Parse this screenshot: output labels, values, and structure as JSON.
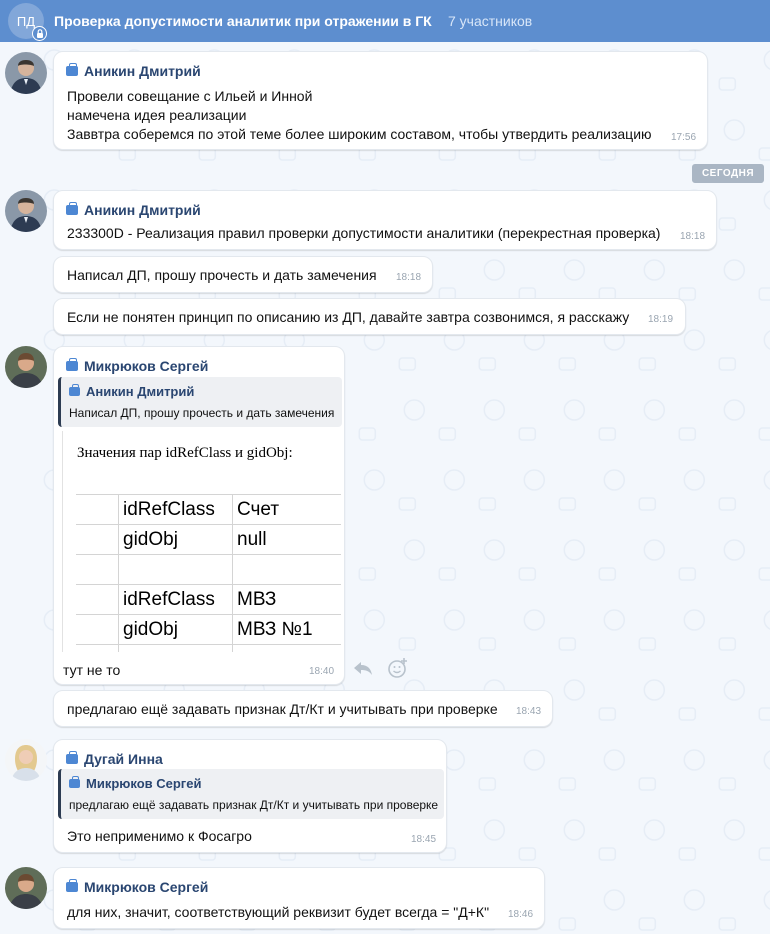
{
  "header": {
    "avatar_initials": "ПД",
    "title": "Проверка допустимости аналитик при отражении в ГК",
    "members": "7 участников"
  },
  "date_divider": "СЕГОДНЯ",
  "messages": [
    {
      "sender": "Аникин Дмитрий",
      "lines": [
        "Провели совещание с Ильей и Инной",
        "намечена идея реализации",
        "Заввтра соберемся по этой теме более широким составом, чтобы утвердить реализацию"
      ],
      "time": "17:56"
    },
    {
      "sender": "Аникин Дмитрий",
      "text": "233300D - Реализация правил проверки допустимости аналитики (перекрестная проверка)",
      "time": "18:18"
    },
    {
      "text": "Написал ДП, прошу прочесть и дать замечения",
      "time": "18:18"
    },
    {
      "text": "Если не понятен принцип по описанию из ДП, давайте завтра созвонимся, я расскажу",
      "time": "18:19"
    },
    {
      "sender": "Микрюков Сергей",
      "quote": {
        "sender": "Аникин Дмитрий",
        "text": "Написал ДП, прошу прочесть и дать замечения"
      },
      "embedded": {
        "title": "Значения пар idRefClass и gidObj:",
        "rows": [
          [
            "idRefClass",
            "Счет"
          ],
          [
            "gidObj",
            "null"
          ],
          [
            "",
            ""
          ],
          [
            "idRefClass",
            "МВЗ"
          ],
          [
            "gidObj",
            "МВЗ №1"
          ]
        ]
      },
      "text": "тут не то",
      "time": "18:40"
    },
    {
      "text": "предлагаю ещё задавать признак Дт/Кт и учитывать при проверке",
      "time": "18:43"
    },
    {
      "sender": "Дугай Инна",
      "quote": {
        "sender": "Микрюков Сергей",
        "text": "предлагаю ещё задавать признак Дт/Кт и учитывать при проверке"
      },
      "text": "Это неприменимо к Фосагро",
      "time": "18:45"
    },
    {
      "sender": "Микрюков Сергей",
      "text": "для них, значит, соответствующий реквизит будет всегда = \"Д+К\"",
      "time": "18:46"
    }
  ],
  "colors": {
    "header_bg": "#5d8ecf",
    "sender_name": "#2a4671",
    "chat_bg": "#f3f7fc"
  }
}
